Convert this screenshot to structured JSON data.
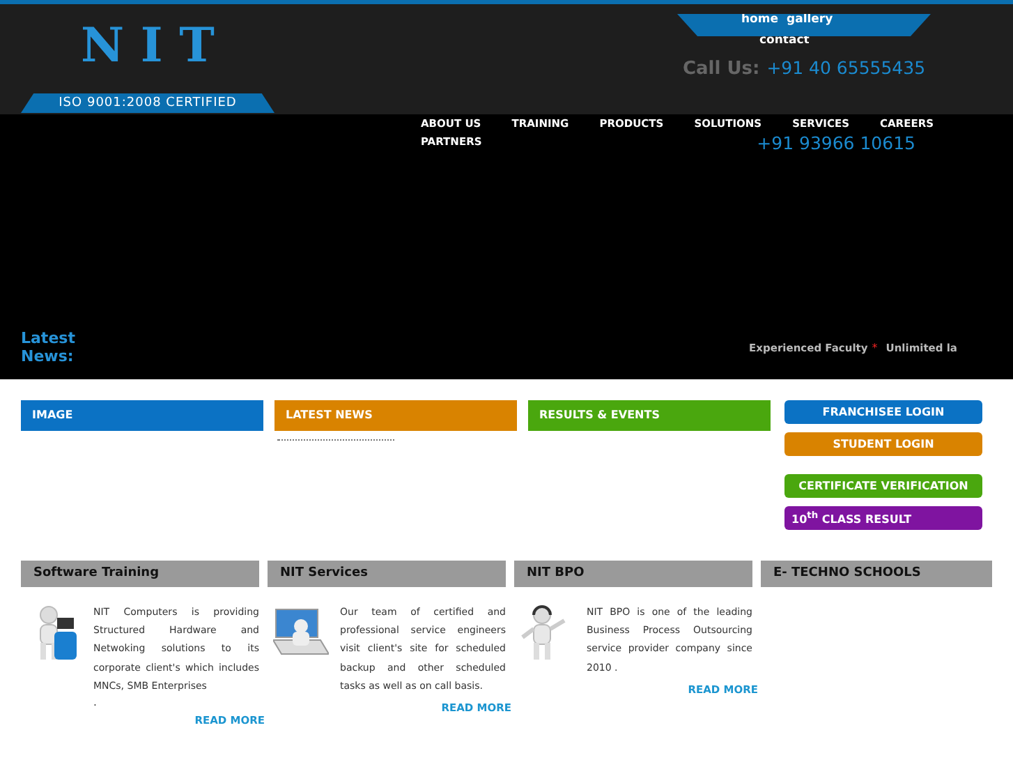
{
  "header": {
    "logo": "N I T",
    "certification": "ISO 9001:2008 CERTIFIED",
    "top_links": [
      "home",
      "gallery",
      "contact"
    ],
    "call_label": "Call Us:",
    "phones": [
      "+91 40 65555435",
      "+91 93966 10615"
    ]
  },
  "nav": [
    "ABOUT US",
    "TRAINING",
    "PRODUCTS",
    "SOLUTIONS",
    "SERVICES",
    "CAREERS",
    "PARTNERS"
  ],
  "news_bar": {
    "label": "Latest News:",
    "separator": "*",
    "ticker": [
      "Experienced Faculty",
      "Unlimited la"
    ]
  },
  "panels": [
    {
      "title": "IMAGE",
      "color": "#0b72c4",
      "kind": "image"
    },
    {
      "title": "LATEST NEWS",
      "color": "#d98300",
      "kind": "news"
    },
    {
      "title": "RESULTS & EVENTS",
      "color": "#4aa70e",
      "kind": "events"
    }
  ],
  "quick_links": [
    {
      "label": "FRANCHISEE LOGIN",
      "color": "#0b72c4",
      "kind": "login"
    },
    {
      "label": "STUDENT LOGIN",
      "color": "#d98300",
      "kind": "login"
    },
    {
      "label": "CERTIFICATE VERIFICATION",
      "color": "#4aa70e",
      "kind": "verify"
    },
    {
      "label": "10$^{th}$ CLASS RESULT",
      "color": "#7f14a0",
      "kind": "result"
    }
  ],
  "sections": [
    {
      "title": "Software Training",
      "kind": "training",
      "text": "NIT Computers is providing Structured Hardware and Netwoking solutions to its corporate client's which includes MNCs, SMB Enterprises",
      "tail": ".",
      "link": "READ MORE"
    },
    {
      "title": "NIT Services",
      "kind": "services",
      "text": "Our team of certified and professional service engineers visit client's site for scheduled backup and other scheduled tasks as well as on call basis.",
      "link": "READ MORE"
    },
    {
      "title": "NIT BPO",
      "kind": "bpo",
      "text": "NIT BPO is one of the leading Business Process Outsourcing service provider company since 2010 .",
      "link": "READ MORE"
    },
    {
      "title": "E- TECHNO SCHOOLS"
    }
  ]
}
